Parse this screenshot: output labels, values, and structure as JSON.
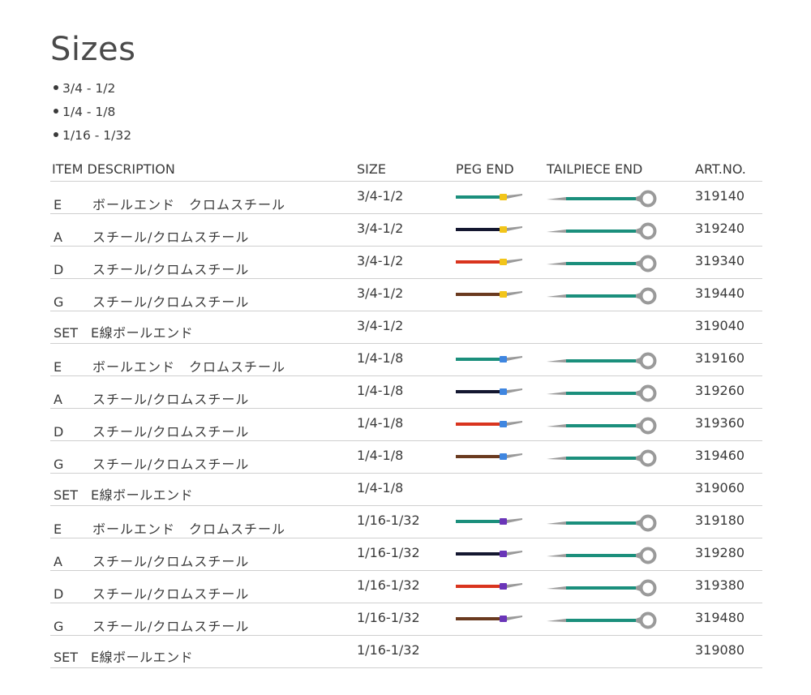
{
  "page": {
    "title": "Sizes",
    "sizes": [
      "3/4 - 1/2",
      "1/4 - 1/8",
      "1/16 - 1/32"
    ]
  },
  "table": {
    "headers": {
      "item": "ITEM DESCRIPTION",
      "size": "SIZE",
      "peg": "PEG END",
      "tail": "TAILPIECE END",
      "art": "ART.NO."
    },
    "rows": [
      {
        "item": "E",
        "desc": "ボールエンド　クロムスチール",
        "size": "3/4-1/2",
        "art": "319140",
        "wire": "#1b8f7c",
        "band": "#f2c51a"
      },
      {
        "item": "A",
        "desc": "スチール/クロムスチール",
        "size": "3/4-1/2",
        "art": "319240",
        "wire": "#141730",
        "band": "#f2c51a"
      },
      {
        "item": "D",
        "desc": "スチール/クロムスチール",
        "size": "3/4-1/2",
        "art": "319340",
        "wire": "#d9341e",
        "band": "#f2c51a"
      },
      {
        "item": "G",
        "desc": "スチール/クロムスチール",
        "size": "3/4-1/2",
        "art": "319440",
        "wire": "#6a3a1f",
        "band": "#f2c51a"
      },
      {
        "item": "SET",
        "desc": "E線ボールエンド",
        "size": "3/4-1/2",
        "art": "319040",
        "set": true
      },
      {
        "item": "E",
        "desc": "ボールエンド　クロムスチール",
        "size": "1/4-1/8",
        "art": "319160",
        "wire": "#1b8f7c",
        "band": "#3f86e0"
      },
      {
        "item": "A",
        "desc": "スチール/クロムスチール",
        "size": "1/4-1/8",
        "art": "319260",
        "wire": "#141730",
        "band": "#3f86e0"
      },
      {
        "item": "D",
        "desc": "スチール/クロムスチール",
        "size": "1/4-1/8",
        "art": "319360",
        "wire": "#d9341e",
        "band": "#3f86e0"
      },
      {
        "item": "G",
        "desc": "スチール/クロムスチール",
        "size": "1/4-1/8",
        "art": "319460",
        "wire": "#6a3a1f",
        "band": "#3f86e0"
      },
      {
        "item": "SET",
        "desc": "E線ボールエンド",
        "size": "1/4-1/8",
        "art": "319060",
        "set": true
      },
      {
        "item": "E",
        "desc": "ボールエンド　クロムスチール",
        "size": "1/16-1/32",
        "art": "319180",
        "wire": "#1b8f7c",
        "band": "#6a35b8"
      },
      {
        "item": "A",
        "desc": "スチール/クロムスチール",
        "size": "1/16-1/32",
        "art": "319280",
        "wire": "#141730",
        "band": "#6a35b8"
      },
      {
        "item": "D",
        "desc": "スチール/クロムスチール",
        "size": "1/16-1/32",
        "art": "319380",
        "wire": "#d9341e",
        "band": "#6a35b8"
      },
      {
        "item": "G",
        "desc": "スチール/クロムスチール",
        "size": "1/16-1/32",
        "art": "319480",
        "wire": "#6a3a1f",
        "band": "#6a35b8"
      },
      {
        "item": "SET",
        "desc": "E線ボールエンド",
        "size": "1/16-1/32",
        "art": "319080",
        "set": true
      }
    ],
    "tailpiece_wire_color": "#1b8f7c",
    "metal_color": "#9a9a9a"
  }
}
